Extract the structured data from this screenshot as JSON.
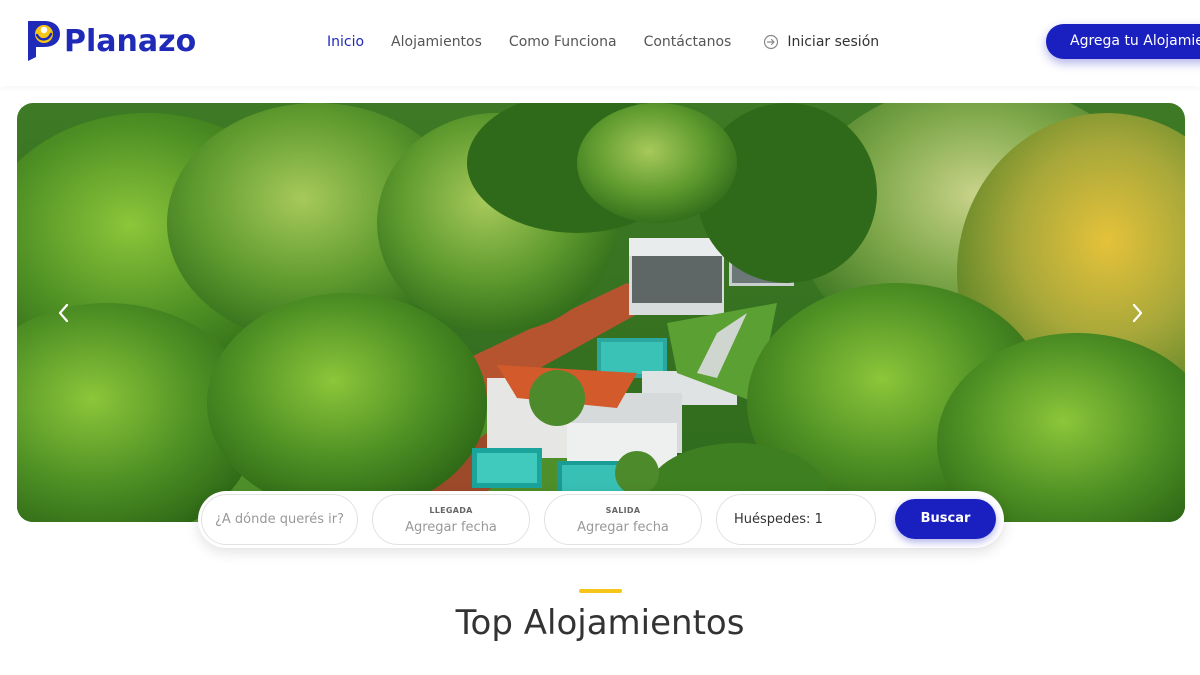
{
  "brand": {
    "name": "Planazo",
    "primary_color": "#1a1fbf",
    "accent_color": "#f5c518"
  },
  "nav": {
    "items": [
      {
        "label": "Inicio",
        "active": true
      },
      {
        "label": "Alojamientos",
        "active": false
      },
      {
        "label": "Como Funciona",
        "active": false
      },
      {
        "label": "Contáctanos",
        "active": false
      }
    ],
    "login_label": "Iniciar sesión",
    "login_icon": "login-arrow-icon",
    "cta_label": "Agrega tu Alojamiento"
  },
  "hero": {
    "image": "aerial view of cabins with pools surrounded by forest",
    "prev_icon": "chevron-left-icon",
    "next_icon": "chevron-right-icon"
  },
  "search": {
    "destination_placeholder": "¿A dónde querés ir?",
    "arrival_label": "LLEGADA",
    "arrival_placeholder": "Agregar fecha",
    "departure_label": "SALIDA",
    "departure_placeholder": "Agregar fecha",
    "guests_value": "Huéspedes: 1",
    "button_label": "Buscar"
  },
  "section": {
    "title": "Top Alojamientos"
  }
}
